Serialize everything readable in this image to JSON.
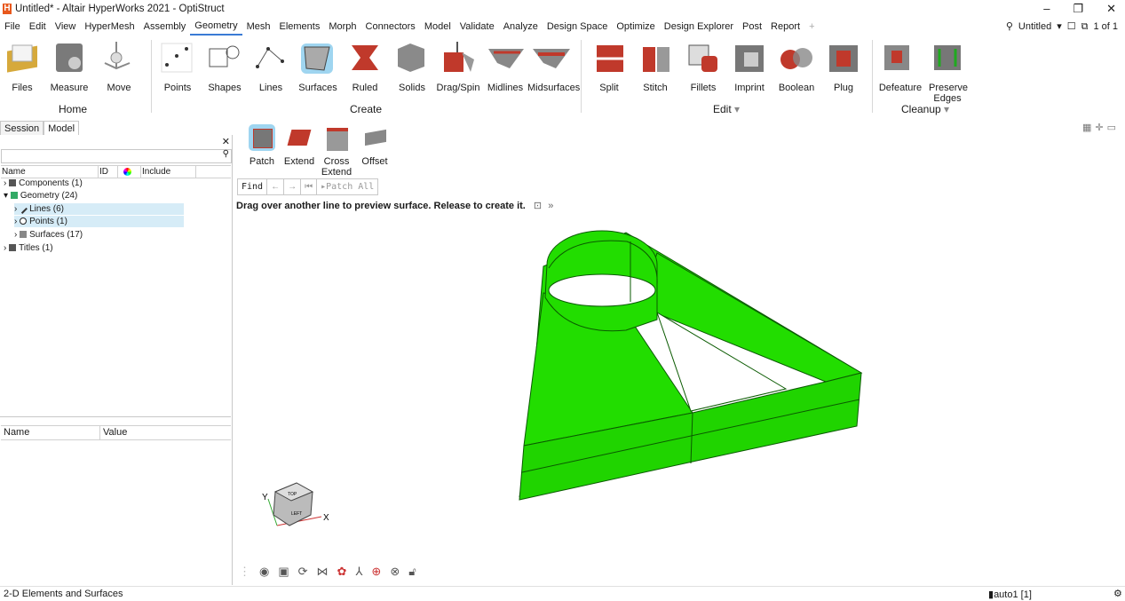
{
  "window": {
    "title": "Untitled* - Altair HyperWorks 2021 - OptiStruct",
    "min": "–",
    "restore": "❐",
    "close": "✕"
  },
  "menu": {
    "items": [
      "File",
      "Edit",
      "View",
      "HyperMesh",
      "Assembly",
      "Geometry",
      "Mesh",
      "Elements",
      "Morph",
      "Connectors",
      "Model",
      "Validate",
      "Analyze",
      "Design Space",
      "Optimize",
      "Design Explorer",
      "Post",
      "Report"
    ],
    "active": "Geometry",
    "plus": "+",
    "session_name": "Untitled",
    "page": "1 of 1"
  },
  "ribbon": {
    "tools": [
      {
        "label": "Files"
      },
      {
        "label": "Measure"
      },
      {
        "label": "Move"
      },
      {
        "label": "Points"
      },
      {
        "label": "Shapes"
      },
      {
        "label": "Lines"
      },
      {
        "label": "Surfaces"
      },
      {
        "label": "Ruled"
      },
      {
        "label": "Solids"
      },
      {
        "label": "Drag/Spin"
      },
      {
        "label": "Midlines"
      },
      {
        "label": "Midsurfaces"
      },
      {
        "label": "Split"
      },
      {
        "label": "Stitch"
      },
      {
        "label": "Fillets"
      },
      {
        "label": "Imprint"
      },
      {
        "label": "Boolean"
      },
      {
        "label": "Plug"
      },
      {
        "label": "Defeature"
      },
      {
        "label": "Preserve Edges"
      }
    ],
    "groups": {
      "home": "Home",
      "create": "Create",
      "edit": "Edit",
      "cleanup": "Cleanup"
    }
  },
  "left_panel": {
    "tabs": [
      "Session",
      "Model"
    ],
    "active_tab": "Model",
    "columns": [
      "Name",
      "ID",
      "",
      "Include"
    ],
    "tree": [
      {
        "label": "Components (1)"
      },
      {
        "label": "Geometry (24)"
      },
      {
        "label": "Lines (6)"
      },
      {
        "label": "Points (1)"
      },
      {
        "label": "Surfaces (17)"
      },
      {
        "label": "Titles (1)"
      }
    ],
    "prop_columns": [
      "Name",
      "Value"
    ]
  },
  "context_tools": [
    {
      "label": "Patch"
    },
    {
      "label": "Extend"
    },
    {
      "label": "Cross Extend"
    },
    {
      "label": "Offset"
    }
  ],
  "findbar": {
    "find": "Find",
    "patch_all": "Patch All"
  },
  "hint": "Drag over another line to preview surface. Release to create it.",
  "triad": {
    "x": "X",
    "y": "Y",
    "top": "TOP",
    "left": "LEFT"
  },
  "status": {
    "left": "2-D Elements and Surfaces",
    "right": "auto1 [1]"
  },
  "colors": {
    "model_green": "#22dd00",
    "model_edge": "#0a5a00",
    "accent": "#3a7bd5"
  }
}
